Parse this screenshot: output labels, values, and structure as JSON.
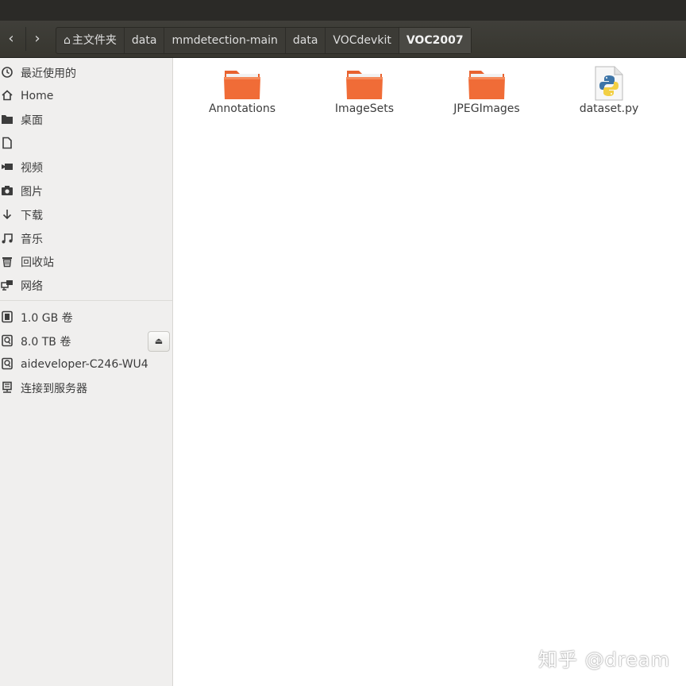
{
  "header": {
    "back_glyph": "‹",
    "forward_glyph": "›",
    "breadcrumbs": [
      "主文件夹",
      "data",
      "mmdetection-main",
      "data",
      "VOCdevkit",
      "VOC2007"
    ]
  },
  "sidebar": {
    "items": [
      {
        "label": "最近使用的",
        "icon": "clock-icon"
      },
      {
        "label": "Home",
        "icon": "home-icon"
      },
      {
        "label": "桌面",
        "icon": "folder-icon"
      },
      {
        "label": "",
        "icon": "document-icon"
      },
      {
        "label": "视频",
        "icon": "video-icon"
      },
      {
        "label": "图片",
        "icon": "camera-icon"
      },
      {
        "label": "下载",
        "icon": "download-icon"
      },
      {
        "label": "音乐",
        "icon": "music-icon"
      },
      {
        "label": "回收站",
        "icon": "trash-icon"
      },
      {
        "label": "网络",
        "icon": "network-icon"
      },
      {
        "label": "1.0 GB 卷",
        "icon": "drive-icon"
      },
      {
        "label": "8.0 TB 卷",
        "icon": "drive-icon"
      },
      {
        "label": "aideveloper-C246-WU4",
        "icon": "drive-icon"
      },
      {
        "label": "连接到服务器",
        "icon": "server-icon"
      }
    ]
  },
  "files": [
    {
      "name": "Annotations",
      "type": "folder"
    },
    {
      "name": "ImageSets",
      "type": "folder"
    },
    {
      "name": "JPEGImages",
      "type": "folder"
    },
    {
      "name": "dataset.py",
      "type": "python-file"
    }
  ],
  "watermark": "知乎 @dream",
  "colors": {
    "folder_orange": "#e8622f",
    "header_dark": "#3c3b36",
    "sidebar_bg": "#f0efee"
  }
}
